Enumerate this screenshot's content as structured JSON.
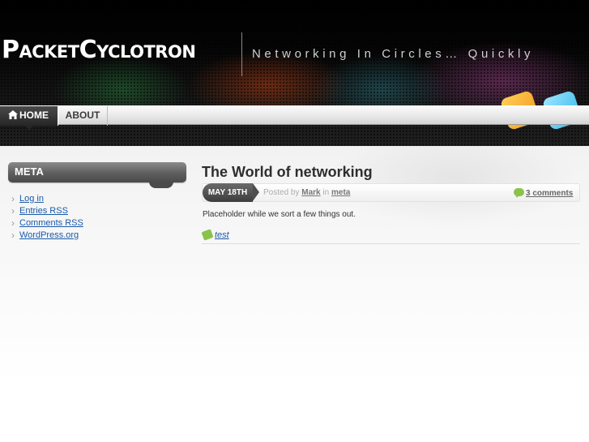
{
  "site": {
    "logo_text": "PacketCyclotron",
    "tagline": "Networking In Circles… Quickly"
  },
  "icons": {
    "home": "home-icon",
    "rss": "rss-icon",
    "twitter": "twitter-icon",
    "comment": "speech-bubble-icon",
    "tag": "tag-icon"
  },
  "colors": {
    "nav_active": "#262626",
    "link": "#1a5aa8",
    "accent_green": "#8bc34a"
  },
  "nav": {
    "items": [
      {
        "label": "HOME",
        "active": true
      },
      {
        "label": "ABOUT",
        "active": false
      }
    ]
  },
  "sidebar": {
    "meta_title": "META",
    "links": [
      {
        "label": "Log in"
      },
      {
        "label": "Entries RSS"
      },
      {
        "label": "Comments RSS"
      },
      {
        "label": "WordPress.org"
      }
    ]
  },
  "post": {
    "title": "The World of networking",
    "date": "MAY 18TH",
    "posted_by_prefix": "Posted by",
    "author": "Mark",
    "in_word": "in",
    "category": "meta",
    "comments": "3 comments",
    "body": "Placeholder while we sort a few things out.",
    "tag": "test"
  }
}
